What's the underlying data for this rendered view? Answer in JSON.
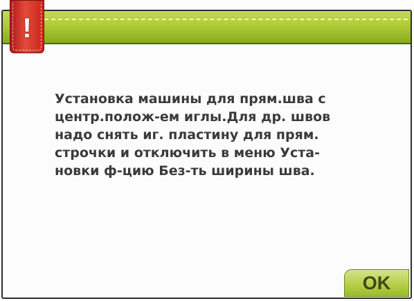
{
  "dialog": {
    "warning_symbol": "!",
    "message": "Установка машины для прям.шва с\nцентр.полож-ем иглы.Для др. швов\nнадо снять иг. пластину для прям.\nстрочки и отключить в меню Уста-\nновки ф-цию Без-ть ширины шва.",
    "ok_label": "OK"
  },
  "colors": {
    "title_bar": "#aecb37",
    "warning_tab": "#d43426",
    "ok_button": "#b6cf4a",
    "text": "#3a3a3a"
  },
  "icons": {
    "warning": "exclamation-icon"
  }
}
